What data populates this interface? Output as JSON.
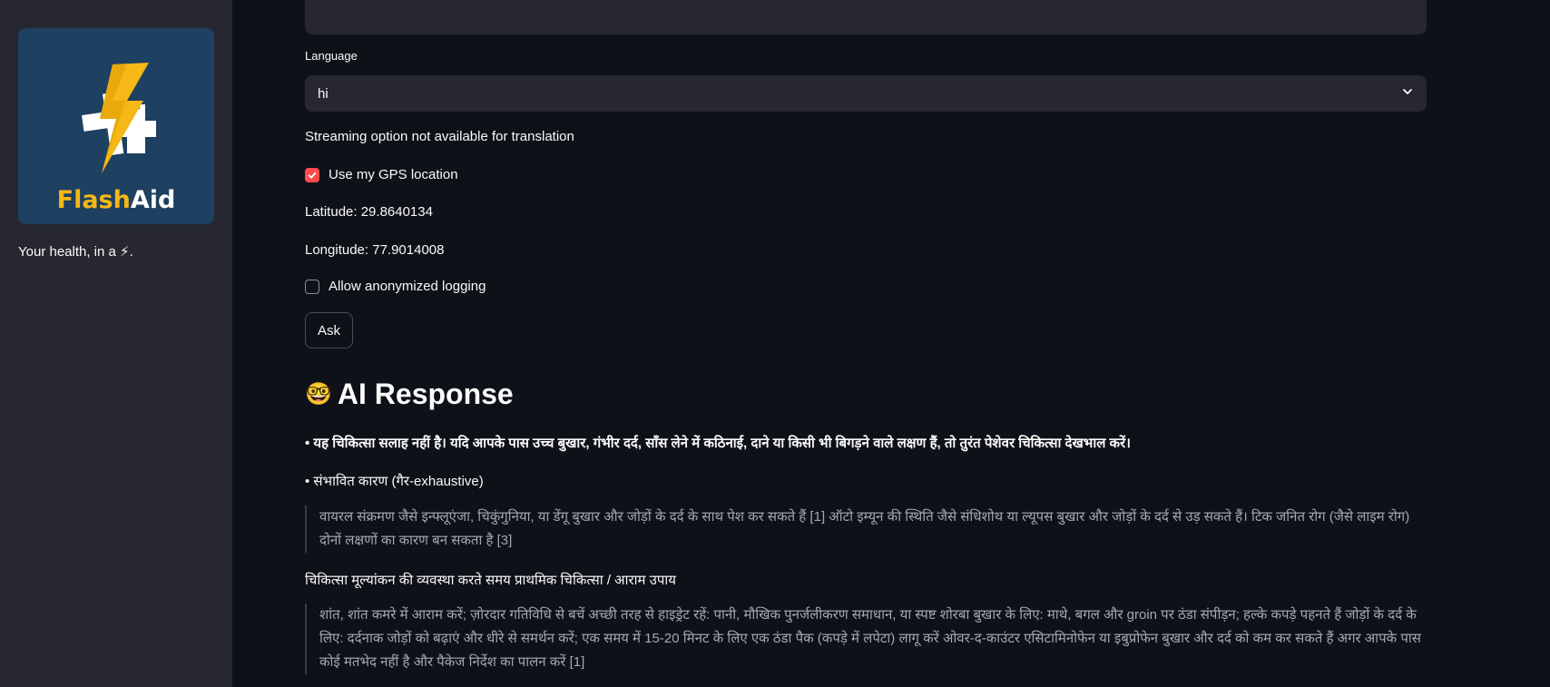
{
  "sidebar": {
    "logo": {
      "word_flash": "Flash",
      "word_aid": "Aid",
      "bg_color": "#1e4061",
      "accent_color": "#f5b817"
    },
    "tagline": "Your health, in a ⚡."
  },
  "form": {
    "language_label": "Language",
    "language_value": "hi",
    "streaming_note": "Streaming option not available for translation",
    "gps_label": "Use my GPS location",
    "gps_checked": true,
    "latitude_text": "Latitude: 29.8640134",
    "longitude_text": "Longitude: 77.9014008",
    "logging_label": "Allow anonymized logging",
    "logging_checked": false,
    "ask_label": "Ask",
    "checkbox_color": "#ff4b4b"
  },
  "response": {
    "title_icon": "🤓",
    "title": "AI Response",
    "disclaimer": "• यह चिकित्सा सलाह नहीं है। यदि आपके पास उच्च बुखार, गंभीर दर्द, साँस लेने में कठिनाई, दाने या किसी भी बिगड़ने वाले लक्षण हैं, तो तुरंत पेशेवर चिकित्सा देखभाल करें।",
    "causes_heading": "• संभावित कारण (गैर-exhaustive)",
    "causes_quote": "वायरल संक्रमण जैसे इन्फ्लूएंजा, चिकुंगुनिया, या डेंगू बुखार और जोड़ों के दर्द के साथ पेश कर सकते हैं [1] ऑटो इम्यून की स्थिति जैसे संधिशोथ या ल्यूपस बुखार और जोड़ों के दर्द से उड़ सकते हैं। टिक जनित रोग (जैसे लाइम रोग) दोनों लक्षणों का कारण बन सकता है [3]",
    "firstaid_heading": "चिकित्सा मूल्यांकन की व्यवस्था करते समय प्राथमिक चिकित्सा / आराम उपाय",
    "firstaid_quote": "शांत, शांत कमरे में आराम करें; ज़ोरदार गतिविधि से बचें अच्छी तरह से हाइड्रेट रहें: पानी, मौखिक पुनर्जलीकरण समाधान, या स्पष्ट शोरबा बुखार के लिए: माथे, बगल और groin पर ठंडा संपीड़न; हल्के कपड़े पहनते हैं जोड़ों के दर्द के लिए: दर्दनाक जोड़ों को बढ़ाएं और धीरे से समर्थन करें; एक समय में 15-20 मिनट के लिए एक ठंडा पैक (कपड़े में लपेटा) लागू करें ओवर-द-काउंटर एसिटामिनोफेन या इबुप्रोफेन बुखार और दर्द को कम कर सकते हैं अगर आपके पास कोई मतभेद नहीं है और पैकेज निर्देश का पालन करें [1]"
  }
}
